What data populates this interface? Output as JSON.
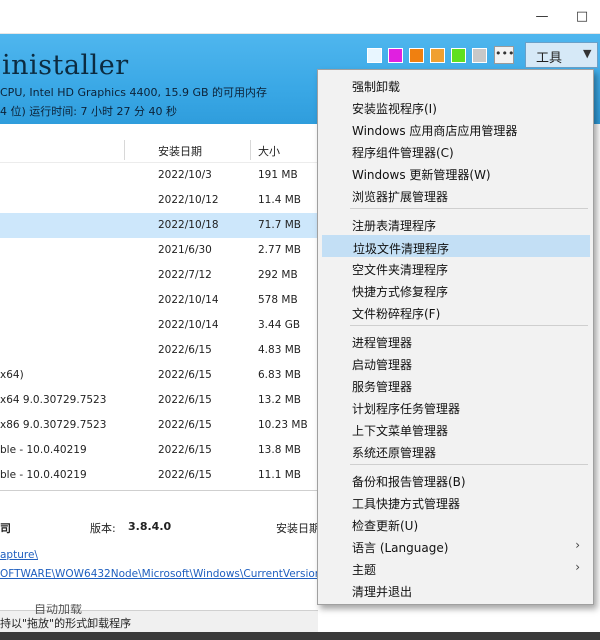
{
  "header": {
    "title": "inistaller",
    "sysinfo": "CPU, Intel HD Graphics 4400, 15.9 GB 的可用内存",
    "sysinfo2": "4 位)  运行时间: 7 小时 27 分 40 秒",
    "swatch_colors": [
      "#e8f6ff",
      "#e020e0",
      "#f08010",
      "#f0a030",
      "#60e020",
      "#c8c8c8"
    ],
    "more_label": "•••",
    "tools_label": "工具",
    "tools_arrow": "▼"
  },
  "window": {
    "minimize": "—",
    "maximize": "□"
  },
  "table": {
    "columns": [
      "安装日期",
      "大小"
    ],
    "rows": [
      {
        "name": "",
        "date": "2022/10/3",
        "size": "191 MB",
        "selected": false
      },
      {
        "name": "",
        "date": "2022/10/12",
        "size": "11.4 MB",
        "selected": false
      },
      {
        "name": "",
        "date": "2022/10/18",
        "size": "71.7 MB",
        "selected": true
      },
      {
        "name": "",
        "date": "2021/6/30",
        "size": "2.77 MB",
        "selected": false
      },
      {
        "name": "",
        "date": "2022/7/12",
        "size": "292 MB",
        "selected": false
      },
      {
        "name": "",
        "date": "2022/10/14",
        "size": "578 MB",
        "selected": false
      },
      {
        "name": "",
        "date": "2022/10/14",
        "size": "3.44 GB",
        "selected": false
      },
      {
        "name": "",
        "date": "2022/6/15",
        "size": "4.83 MB",
        "selected": false
      },
      {
        "name": "x64)",
        "date": "2022/6/15",
        "size": "6.83 MB",
        "selected": false
      },
      {
        "name": "x64 9.0.30729.7523",
        "date": "2022/6/15",
        "size": "13.2 MB",
        "selected": false
      },
      {
        "name": "x86 9.0.30729.7523",
        "date": "2022/6/15",
        "size": "10.23 MB",
        "selected": false
      },
      {
        "name": "ble - 10.0.40219",
        "date": "2022/6/15",
        "size": "13.8 MB",
        "selected": false
      },
      {
        "name": "ble - 10.0.40219",
        "date": "2022/6/15",
        "size": "11.1 MB",
        "selected": false
      }
    ]
  },
  "details": {
    "company": "司",
    "version_label": "版本:",
    "version": "3.8.4.0",
    "install_date_label": "安装日期",
    "link1": "apture\\",
    "link2": "OFTWARE\\WOW6432Node\\Microsoft\\Windows\\CurrentVersion\\Uni"
  },
  "status": {
    "text": "持以\"拖放\"的形式卸载程序"
  },
  "menu": {
    "items": [
      {
        "label": "强制卸载"
      },
      {
        "label": "安装监视程序(I)"
      },
      {
        "label": "Windows 应用商店应用管理器"
      },
      {
        "label": "程序组件管理器(C)"
      },
      {
        "label": "Windows 更新管理器(W)"
      },
      {
        "label": "浏览器扩展管理器"
      },
      {
        "label": "注册表清理程序"
      },
      {
        "label": "垃圾文件清理程序",
        "highlighted": true
      },
      {
        "label": "空文件夹清理程序"
      },
      {
        "label": "快捷方式修复程序"
      },
      {
        "label": "文件粉碎程序(F)"
      },
      {
        "label": "进程管理器"
      },
      {
        "label": "启动管理器"
      },
      {
        "label": "服务管理器"
      },
      {
        "label": "计划程序任务管理器"
      },
      {
        "label": "上下文菜单管理器"
      },
      {
        "label": "系统还原管理器"
      },
      {
        "label": "备份和报告管理器(B)"
      },
      {
        "label": "工具快捷方式管理器"
      },
      {
        "label": "检查更新(U)"
      },
      {
        "label": "语言 (Language)",
        "submenu": true
      },
      {
        "label": "主题",
        "submenu": true
      },
      {
        "label": "清理并退出"
      }
    ],
    "submenu_arrow": "›",
    "partial_label": "自动加载"
  }
}
